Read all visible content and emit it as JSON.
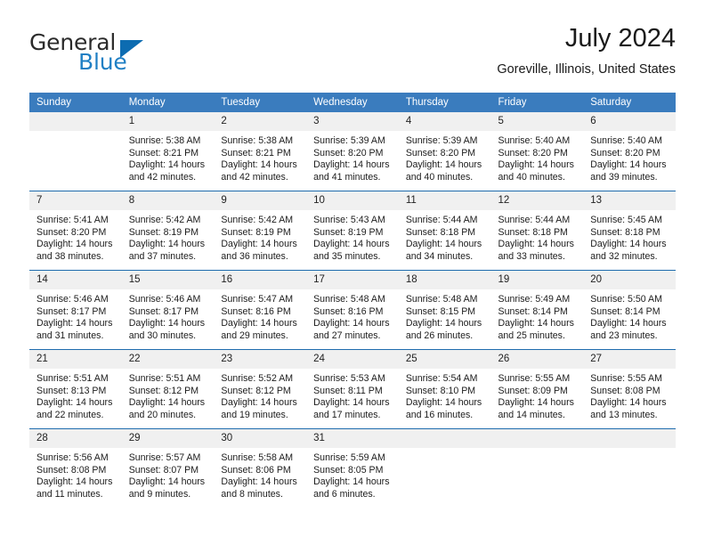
{
  "brand": {
    "name_top": "General",
    "name_bottom": "Blue",
    "accent_color": "#1f7fc4",
    "triangle_color": "#0d6cb1"
  },
  "header": {
    "title": "July 2024",
    "subtitle": "Goreville, Illinois, United States"
  },
  "calendar": {
    "header_bg": "#3a7cbe",
    "daynum_bg": "#f0f0f0",
    "separator_color": "#1f6cae",
    "weekday_names": [
      "Sunday",
      "Monday",
      "Tuesday",
      "Wednesday",
      "Thursday",
      "Friday",
      "Saturday"
    ],
    "weeks": [
      [
        {
          "day": "",
          "blank": true,
          "lines": []
        },
        {
          "day": "1",
          "lines": [
            "Sunrise: 5:38 AM",
            "Sunset: 8:21 PM",
            "Daylight: 14 hours",
            "and 42 minutes."
          ]
        },
        {
          "day": "2",
          "lines": [
            "Sunrise: 5:38 AM",
            "Sunset: 8:21 PM",
            "Daylight: 14 hours",
            "and 42 minutes."
          ]
        },
        {
          "day": "3",
          "lines": [
            "Sunrise: 5:39 AM",
            "Sunset: 8:20 PM",
            "Daylight: 14 hours",
            "and 41 minutes."
          ]
        },
        {
          "day": "4",
          "lines": [
            "Sunrise: 5:39 AM",
            "Sunset: 8:20 PM",
            "Daylight: 14 hours",
            "and 40 minutes."
          ]
        },
        {
          "day": "5",
          "lines": [
            "Sunrise: 5:40 AM",
            "Sunset: 8:20 PM",
            "Daylight: 14 hours",
            "and 40 minutes."
          ]
        },
        {
          "day": "6",
          "lines": [
            "Sunrise: 5:40 AM",
            "Sunset: 8:20 PM",
            "Daylight: 14 hours",
            "and 39 minutes."
          ]
        }
      ],
      [
        {
          "day": "7",
          "lines": [
            "Sunrise: 5:41 AM",
            "Sunset: 8:20 PM",
            "Daylight: 14 hours",
            "and 38 minutes."
          ]
        },
        {
          "day": "8",
          "lines": [
            "Sunrise: 5:42 AM",
            "Sunset: 8:19 PM",
            "Daylight: 14 hours",
            "and 37 minutes."
          ]
        },
        {
          "day": "9",
          "lines": [
            "Sunrise: 5:42 AM",
            "Sunset: 8:19 PM",
            "Daylight: 14 hours",
            "and 36 minutes."
          ]
        },
        {
          "day": "10",
          "lines": [
            "Sunrise: 5:43 AM",
            "Sunset: 8:19 PM",
            "Daylight: 14 hours",
            "and 35 minutes."
          ]
        },
        {
          "day": "11",
          "lines": [
            "Sunrise: 5:44 AM",
            "Sunset: 8:18 PM",
            "Daylight: 14 hours",
            "and 34 minutes."
          ]
        },
        {
          "day": "12",
          "lines": [
            "Sunrise: 5:44 AM",
            "Sunset: 8:18 PM",
            "Daylight: 14 hours",
            "and 33 minutes."
          ]
        },
        {
          "day": "13",
          "lines": [
            "Sunrise: 5:45 AM",
            "Sunset: 8:18 PM",
            "Daylight: 14 hours",
            "and 32 minutes."
          ]
        }
      ],
      [
        {
          "day": "14",
          "lines": [
            "Sunrise: 5:46 AM",
            "Sunset: 8:17 PM",
            "Daylight: 14 hours",
            "and 31 minutes."
          ]
        },
        {
          "day": "15",
          "lines": [
            "Sunrise: 5:46 AM",
            "Sunset: 8:17 PM",
            "Daylight: 14 hours",
            "and 30 minutes."
          ]
        },
        {
          "day": "16",
          "lines": [
            "Sunrise: 5:47 AM",
            "Sunset: 8:16 PM",
            "Daylight: 14 hours",
            "and 29 minutes."
          ]
        },
        {
          "day": "17",
          "lines": [
            "Sunrise: 5:48 AM",
            "Sunset: 8:16 PM",
            "Daylight: 14 hours",
            "and 27 minutes."
          ]
        },
        {
          "day": "18",
          "lines": [
            "Sunrise: 5:48 AM",
            "Sunset: 8:15 PM",
            "Daylight: 14 hours",
            "and 26 minutes."
          ]
        },
        {
          "day": "19",
          "lines": [
            "Sunrise: 5:49 AM",
            "Sunset: 8:14 PM",
            "Daylight: 14 hours",
            "and 25 minutes."
          ]
        },
        {
          "day": "20",
          "lines": [
            "Sunrise: 5:50 AM",
            "Sunset: 8:14 PM",
            "Daylight: 14 hours",
            "and 23 minutes."
          ]
        }
      ],
      [
        {
          "day": "21",
          "lines": [
            "Sunrise: 5:51 AM",
            "Sunset: 8:13 PM",
            "Daylight: 14 hours",
            "and 22 minutes."
          ]
        },
        {
          "day": "22",
          "lines": [
            "Sunrise: 5:51 AM",
            "Sunset: 8:12 PM",
            "Daylight: 14 hours",
            "and 20 minutes."
          ]
        },
        {
          "day": "23",
          "lines": [
            "Sunrise: 5:52 AM",
            "Sunset: 8:12 PM",
            "Daylight: 14 hours",
            "and 19 minutes."
          ]
        },
        {
          "day": "24",
          "lines": [
            "Sunrise: 5:53 AM",
            "Sunset: 8:11 PM",
            "Daylight: 14 hours",
            "and 17 minutes."
          ]
        },
        {
          "day": "25",
          "lines": [
            "Sunrise: 5:54 AM",
            "Sunset: 8:10 PM",
            "Daylight: 14 hours",
            "and 16 minutes."
          ]
        },
        {
          "day": "26",
          "lines": [
            "Sunrise: 5:55 AM",
            "Sunset: 8:09 PM",
            "Daylight: 14 hours",
            "and 14 minutes."
          ]
        },
        {
          "day": "27",
          "lines": [
            "Sunrise: 5:55 AM",
            "Sunset: 8:08 PM",
            "Daylight: 14 hours",
            "and 13 minutes."
          ]
        }
      ],
      [
        {
          "day": "28",
          "lines": [
            "Sunrise: 5:56 AM",
            "Sunset: 8:08 PM",
            "Daylight: 14 hours",
            "and 11 minutes."
          ]
        },
        {
          "day": "29",
          "lines": [
            "Sunrise: 5:57 AM",
            "Sunset: 8:07 PM",
            "Daylight: 14 hours",
            "and 9 minutes."
          ]
        },
        {
          "day": "30",
          "lines": [
            "Sunrise: 5:58 AM",
            "Sunset: 8:06 PM",
            "Daylight: 14 hours",
            "and 8 minutes."
          ]
        },
        {
          "day": "31",
          "lines": [
            "Sunrise: 5:59 AM",
            "Sunset: 8:05 PM",
            "Daylight: 14 hours",
            "and 6 minutes."
          ]
        },
        {
          "day": "",
          "blank": true,
          "lines": []
        },
        {
          "day": "",
          "blank": true,
          "lines": []
        },
        {
          "day": "",
          "blank": true,
          "lines": []
        }
      ]
    ]
  }
}
